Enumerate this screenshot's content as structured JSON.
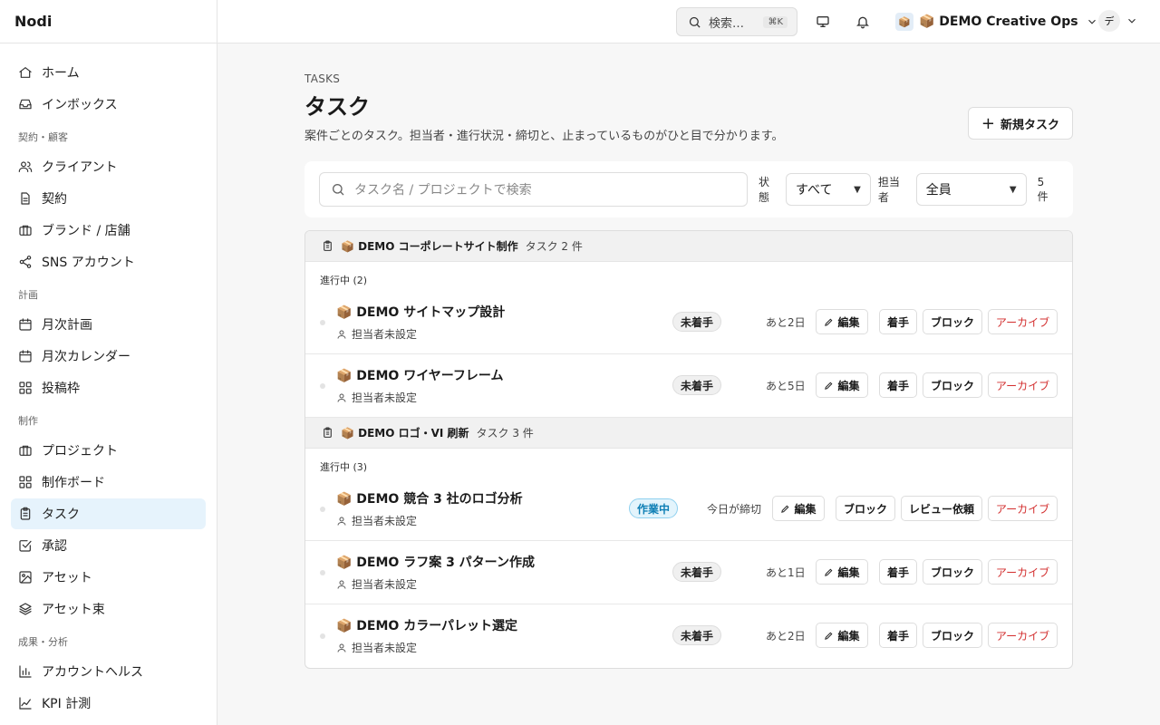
{
  "app": {
    "name": "Nodi"
  },
  "sidebar": {
    "items": [
      {
        "label": "ホーム",
        "icon": "home-icon"
      },
      {
        "label": "インボックス",
        "icon": "inbox-icon"
      },
      {
        "section": "契約・顧客"
      },
      {
        "label": "クライアント",
        "icon": "users-icon"
      },
      {
        "label": "契約",
        "icon": "document-icon"
      },
      {
        "label": "ブランド / 店舗",
        "icon": "briefcase-icon"
      },
      {
        "label": "SNS アカウント",
        "icon": "share-icon"
      },
      {
        "section": "計画"
      },
      {
        "label": "月次計画",
        "icon": "calendar-icon"
      },
      {
        "label": "月次カレンダー",
        "icon": "calendar-icon"
      },
      {
        "label": "投稿枠",
        "icon": "grid-icon"
      },
      {
        "section": "制作"
      },
      {
        "label": "プロジェクト",
        "icon": "briefcase-icon"
      },
      {
        "label": "制作ボード",
        "icon": "grid-icon"
      },
      {
        "label": "タスク",
        "icon": "clipboard-icon",
        "active": true
      },
      {
        "label": "承認",
        "icon": "check-square-icon"
      },
      {
        "label": "アセット",
        "icon": "image-icon"
      },
      {
        "label": "アセット束",
        "icon": "layers-icon"
      },
      {
        "section": "成果・分析"
      },
      {
        "label": "アカウントヘルス",
        "icon": "bar-chart-icon"
      },
      {
        "label": "KPI 計測",
        "icon": "line-chart-icon"
      }
    ]
  },
  "topbar": {
    "search_label": "検索…",
    "search_shortcut": "⌘K",
    "workspace_emoji": "📦",
    "workspace_name": "📦 DEMO Creative Ops",
    "avatar_initial": "デ"
  },
  "page": {
    "eyebrow": "TASKS",
    "title": "タスク",
    "subtitle": "案件ごとのタスク。担当者・進行状況・締切と、止まっているものがひと目で分かります。",
    "new_button": "新規タスク"
  },
  "filters": {
    "search_placeholder": "タスク名 / プロジェクトで検索",
    "status_label": "状態",
    "status_value": "すべて",
    "assignee_label": "担当者",
    "assignee_value": "全員",
    "count": "5 件"
  },
  "groups": [
    {
      "title": "📦 DEMO コーポレートサイト制作",
      "count": "タスク 2 件",
      "status_heading": "進行中 (2)",
      "tasks": [
        {
          "name": "📦 DEMO サイトマップ設計",
          "assignee": "担当者未設定",
          "badge": "未着手",
          "badge_type": "todo",
          "due": "あと2日",
          "actions": [
            "編集",
            "着手",
            "ブロック",
            "アーカイブ"
          ]
        },
        {
          "name": "📦 DEMO ワイヤーフレーム",
          "assignee": "担当者未設定",
          "badge": "未着手",
          "badge_type": "todo",
          "due": "あと5日",
          "actions": [
            "編集",
            "着手",
            "ブロック",
            "アーカイブ"
          ]
        }
      ]
    },
    {
      "title": "📦 DEMO ロゴ・VI 刷新",
      "count": "タスク 3 件",
      "status_heading": "進行中 (3)",
      "tasks": [
        {
          "name": "📦 DEMO 競合 3 社のロゴ分析",
          "assignee": "担当者未設定",
          "badge": "作業中",
          "badge_type": "wip",
          "due": "今日が締切",
          "actions": [
            "編集",
            "ブロック",
            "レビュー依頼",
            "アーカイブ"
          ]
        },
        {
          "name": "📦 DEMO ラフ案 3 パターン作成",
          "assignee": "担当者未設定",
          "badge": "未着手",
          "badge_type": "todo",
          "due": "あと1日",
          "actions": [
            "編集",
            "着手",
            "ブロック",
            "アーカイブ"
          ]
        },
        {
          "name": "📦 DEMO カラーパレット選定",
          "assignee": "担当者未設定",
          "badge": "未着手",
          "badge_type": "todo",
          "due": "あと2日",
          "actions": [
            "編集",
            "着手",
            "ブロック",
            "アーカイブ"
          ]
        }
      ]
    }
  ],
  "colors": {
    "accent": "#0f7fb5",
    "active_bg": "#e6f3fc",
    "danger": "#d32f2f"
  }
}
